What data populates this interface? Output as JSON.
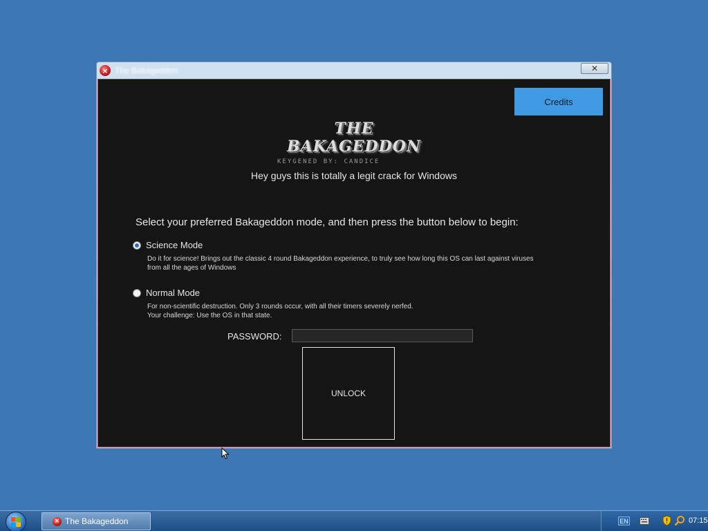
{
  "window": {
    "title": "The Bakageddon",
    "close_glyph": "✕",
    "credits_label": "Credits",
    "logo_title": "THE BAKAGEDDON",
    "logo_subtitle": "KEYGENED BY: CANDICE",
    "tagline": "Hey guys this is totally a legit crack for Windows",
    "prompt": "Select your preferred Bakageddon mode, and then press the button below to begin:",
    "modes": [
      {
        "label": "Science Mode",
        "checked": true,
        "description_lines": [
          "Do it for science! Brings out the classic 4 round Bakageddon experience, to truly see how long this OS can last against viruses",
          "from all the ages of Windows"
        ]
      },
      {
        "label": "Normal Mode",
        "checked": false,
        "description_lines": [
          "For non-scientific destruction. Only 3 rounds occur, with all their timers severely nerfed.",
          "Your challenge: Use the OS in that state."
        ]
      }
    ],
    "password_label": "PASSWORD:",
    "password_value": "",
    "unlock_label": "UNLOCK"
  },
  "taskbar": {
    "task_title": "The Bakageddon",
    "language": "EN",
    "clock": "07:15"
  },
  "icons": {
    "app": "error-x-icon",
    "start": "windows-start-orb-icon",
    "keyboard": "keyboard-icon",
    "shield": "security-shield-icon",
    "search": "search-icon"
  },
  "colors": {
    "desktop": "#3d78b5",
    "client_bg": "#151515",
    "credits_bg": "#3f9ae3",
    "taskbar": "#2a5f99"
  }
}
